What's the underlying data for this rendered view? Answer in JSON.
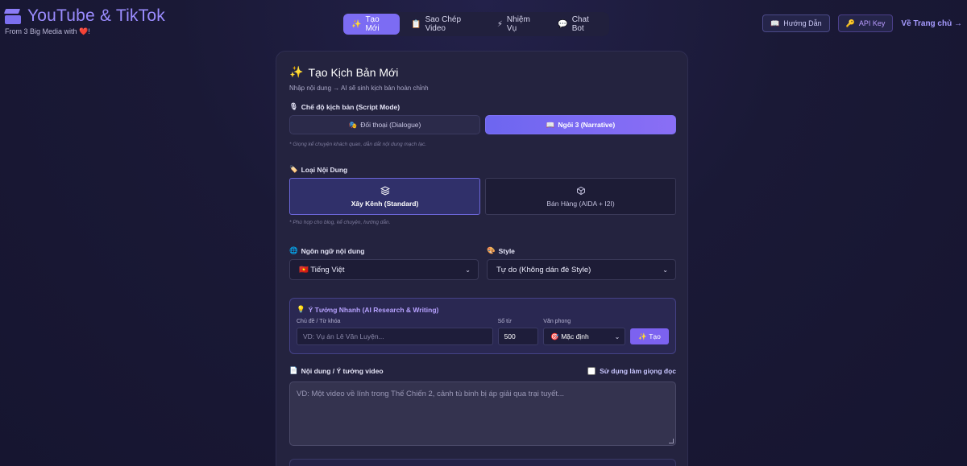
{
  "brand": {
    "title": "YouTube & TikTok",
    "subtitle_prefix": "From 3 Big Media with",
    "heart": "❤️",
    "subtitle_suffix": "!",
    "icon": "clapperboard-icon"
  },
  "nav": {
    "items": [
      {
        "label": "Tạo Mới",
        "icon": "✨",
        "active": true
      },
      {
        "label": "Sao Chép Video",
        "icon": "📋",
        "active": false
      },
      {
        "label": "Nhiệm Vụ",
        "icon": "⚡",
        "active": false
      },
      {
        "label": "Chat Bot",
        "icon": "💬",
        "active": false
      }
    ]
  },
  "top_right": {
    "guide": {
      "label": "Hướng Dẫn",
      "icon": "📖"
    },
    "api": {
      "label": "API Key",
      "icon": "🔑"
    },
    "home": "Về Trang chủ →"
  },
  "card": {
    "title_icon": "✨",
    "title": "Tạo Kịch Bản Mới",
    "subtitle": "Nhập nội dung → AI sẽ sinh kịch bản hoàn chỉnh",
    "script_mode": {
      "icon": "🎙",
      "label": "Chế độ kịch bản (Script Mode)",
      "options": [
        {
          "icon": "🎭",
          "label": "Đối thoại (Dialogue)",
          "active": false
        },
        {
          "icon": "📖",
          "label": "Ngôi 3 (Narrative)",
          "active": true
        }
      ],
      "note": "* Giọng kể chuyện khách quan, dẫn dắt nội dung mạch lạc."
    },
    "content_type": {
      "icon": "🏷️",
      "label": "Loại Nội Dung",
      "options": [
        {
          "icon": "layers-icon",
          "label": "Xây Kênh (Standard)",
          "active": true
        },
        {
          "icon": "box-icon",
          "label": "Bán Hàng (AIDA + I2I)",
          "active": false
        }
      ],
      "note": "* Phù hợp cho blog, kể chuyện, hướng dẫn."
    },
    "language": {
      "icon": "🌐",
      "label": "Ngôn ngữ nội dung",
      "value": "🇻🇳 Tiếng Việt"
    },
    "style": {
      "icon": "🎨",
      "label": "Style",
      "value": "Tự do (Không dán đè Style)"
    },
    "quick_idea": {
      "icon": "💡",
      "title": "Ý Tưởng Nhanh (AI Research & Writing)",
      "topic_label": "Chủ đề / Từ khóa",
      "topic_placeholder": "VD: Vụ án Lê Văn Luyện...",
      "words_label": "Số từ",
      "words_value": "500",
      "tone_label": "Văn phong",
      "tone_value": "🎯 Mặc định",
      "create_button": "✨ Tạo"
    },
    "content": {
      "icon": "📄",
      "label": "Nội dung / Ý tưởng video",
      "use_voice_label": "Sử dụng làm giọng đọc",
      "placeholder": "VD: Một video về lính trong Thế Chiến 2, cảnh tù binh bị áp giải qua trại tuyết..."
    }
  }
}
